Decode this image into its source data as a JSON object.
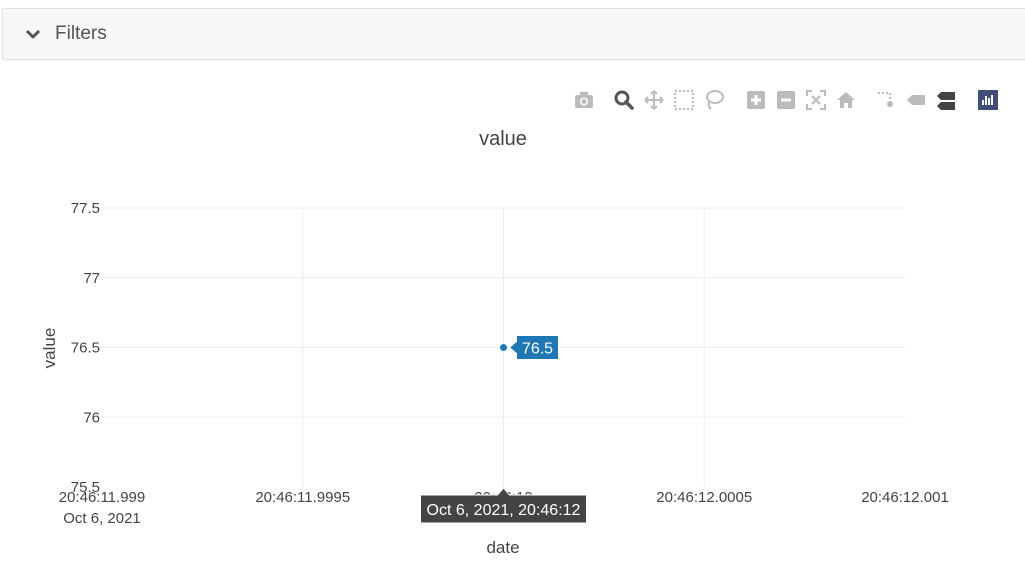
{
  "filters": {
    "label": "Filters"
  },
  "modebar": {
    "buttons": [
      {
        "name": "camera-icon"
      },
      {
        "name": "zoom-icon"
      },
      {
        "name": "pan-icon"
      },
      {
        "name": "box-select-icon"
      },
      {
        "name": "lasso-select-icon"
      },
      {
        "name": "zoom-in-icon"
      },
      {
        "name": "zoom-out-icon"
      },
      {
        "name": "autoscale-icon"
      },
      {
        "name": "reset-axes-icon"
      },
      {
        "name": "spike-lines-icon"
      },
      {
        "name": "hover-closest-icon"
      },
      {
        "name": "hover-compare-icon"
      },
      {
        "name": "plotly-logo-icon"
      }
    ]
  },
  "chart_data": {
    "type": "scatter",
    "title": "value",
    "xlabel": "date",
    "ylabel": "value",
    "x_tick_labels": [
      {
        "time": "20:46:11.999",
        "date": "Oct 6, 2021"
      },
      {
        "time": "20:46:11.9995",
        "date": ""
      },
      {
        "time": "20:46:12",
        "date": ""
      },
      {
        "time": "20:46:12.0005",
        "date": ""
      },
      {
        "time": "20:46:12.001",
        "date": ""
      }
    ],
    "y_tick_labels": [
      "75.5",
      "76",
      "76.5",
      "77",
      "77.5"
    ],
    "y_ticks": [
      75.5,
      76,
      76.5,
      77,
      77.5
    ],
    "ylim": [
      75.5,
      77.5
    ],
    "xlim": [
      "2021-10-06T20:46:11.999",
      "2021-10-06T20:46:12.001"
    ],
    "points": [
      {
        "x": "2021-10-06T20:46:12.000",
        "y": 76.5
      }
    ],
    "hover": {
      "y_label": "76.5",
      "x_label": "Oct 6, 2021, 20:46:12"
    },
    "grid": true,
    "colors": {
      "marker": "#1f77b4",
      "hover_bg": "#1f77b4",
      "x_hover_bg": "#444444",
      "grid": "#eeeeee"
    }
  }
}
